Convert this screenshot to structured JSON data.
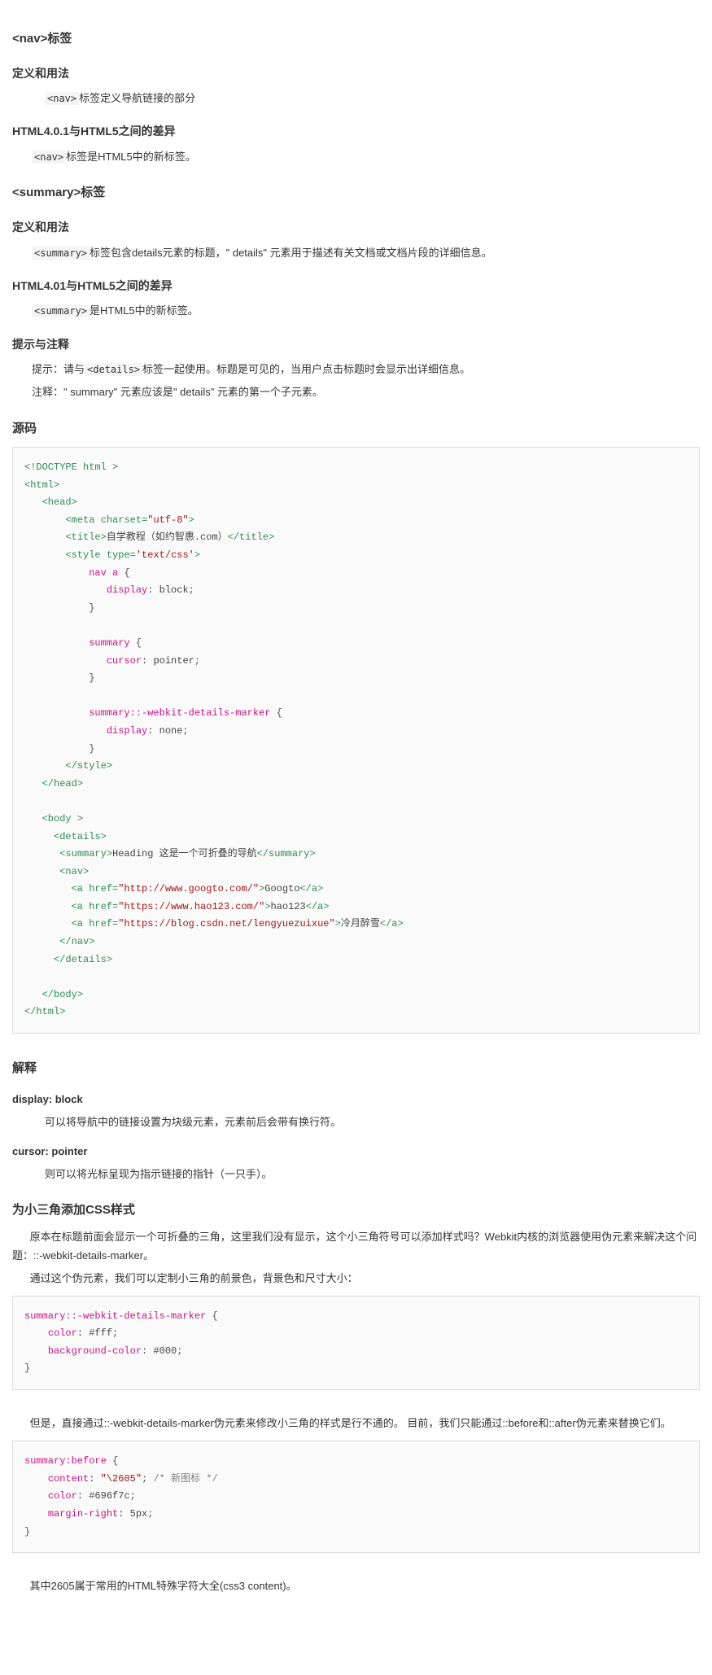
{
  "nav": {
    "title": "<nav>标签",
    "def_h": "定义和用法",
    "def_t": "标签定义导航链接的部分",
    "def_tag": "<nav>",
    "diff_h": "HTML4.0.1与HTML5之间的差异",
    "diff_t": "标签是HTML5中的新标签。",
    "diff_tag": "<nav>"
  },
  "summary": {
    "title": "<summary>标签",
    "def_h": "定义和用法",
    "def_tag": "<summary>",
    "def_t": "标签包含details元素的标题，\" details\" 元素用于描述有关文档或文档片段的详细信息。",
    "diff_h": "HTML4.01与HTML5之间的差异",
    "diff_tag": "<summary>",
    "diff_t": "是HTML5中的新标签。",
    "tip_h": "提示与注释",
    "tip_label": "提示：请与",
    "tip_tag": "<details>",
    "tip_after": "标签一起使用。标题是可见的，当用户点击标题时会显示出详细信息。",
    "note": "注释：\" summary\" 元素应该是\" details\" 元素的第一个子元素。"
  },
  "src": {
    "title": "源码"
  },
  "expl": {
    "title": "解释",
    "block_h": "display: block",
    "block_t": "可以将导航中的链接设置为块级元素，元素前后会带有换行符。",
    "cursor_h": "cursor: pointer",
    "cursor_t": "则可以将光标呈现为指示链接的指针（一只手）。"
  },
  "css": {
    "title": "为小三角添加CSS样式",
    "p1": "原本在标题前面会显示一个可折叠的三角，这里我们没有显示，这个小三角符号可以添加样式吗？Webkit内核的浏览器使用伪元素来解决这个问题：::-webkit-details-marker。",
    "p2": "通过这个伪元素，我们可以定制小三角的前景色，背景色和尺寸大小：",
    "mid": "但是，直接通过::-webkit-details-marker伪元素来修改小三角的样式是行不通的。 目前，我们只能通过::before和::after伪元素来替换它们。",
    "end": "其中2605属于常用的HTML特殊字符大全(css3 content)。"
  }
}
